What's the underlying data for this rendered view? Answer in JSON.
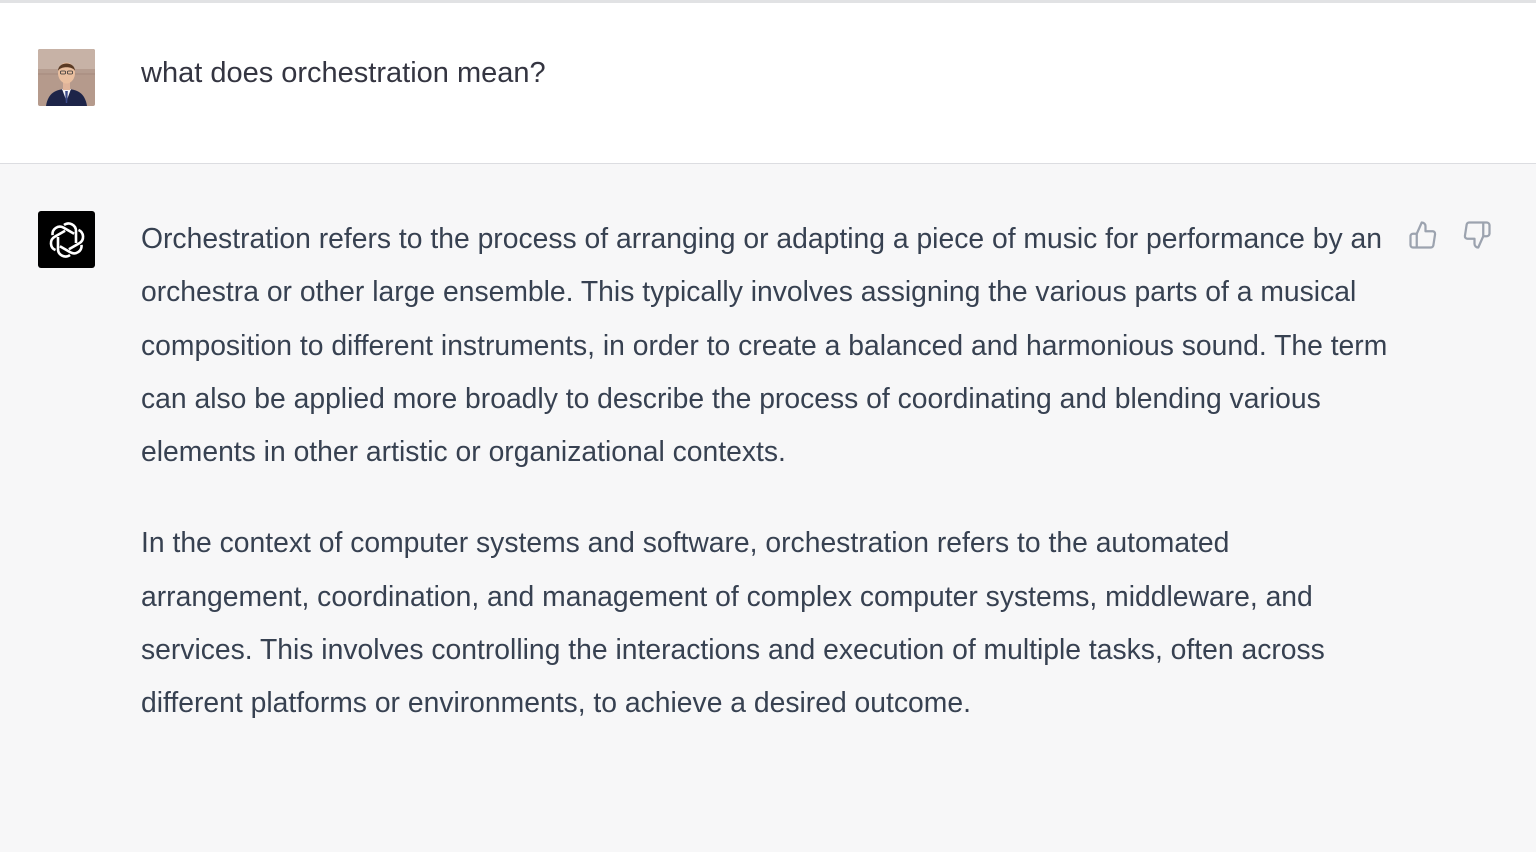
{
  "conversation": {
    "user_message": {
      "avatar_icon": "user-avatar-photo",
      "text": "what does orchestration mean?"
    },
    "assistant_message": {
      "avatar_icon": "openai-logo-icon",
      "paragraphs": [
        "Orchestration refers to the process of arranging or adapting a piece of music for performance by an orchestra or other large ensemble. This typically involves assigning the various parts of a musical composition to different instruments, in order to create a balanced and harmonious sound. The term can also be applied more broadly to describe the process of coordinating and blending various elements in other artistic or organizational contexts.",
        "In the context of computer systems and software, orchestration refers to the automated arrangement, coordination, and management of complex computer systems, middleware, and services. This involves controlling the interactions and execution of multiple tasks, often across different platforms or environments, to achieve a desired outcome."
      ],
      "feedback": {
        "thumbs_up_icon": "thumbs-up-icon",
        "thumbs_down_icon": "thumbs-down-icon"
      }
    }
  },
  "colors": {
    "user_background": "#ffffff",
    "assistant_background": "#f7f7f8",
    "text": "#374151",
    "bot_avatar_background": "#000000",
    "icon_gray": "#9ca3af"
  }
}
